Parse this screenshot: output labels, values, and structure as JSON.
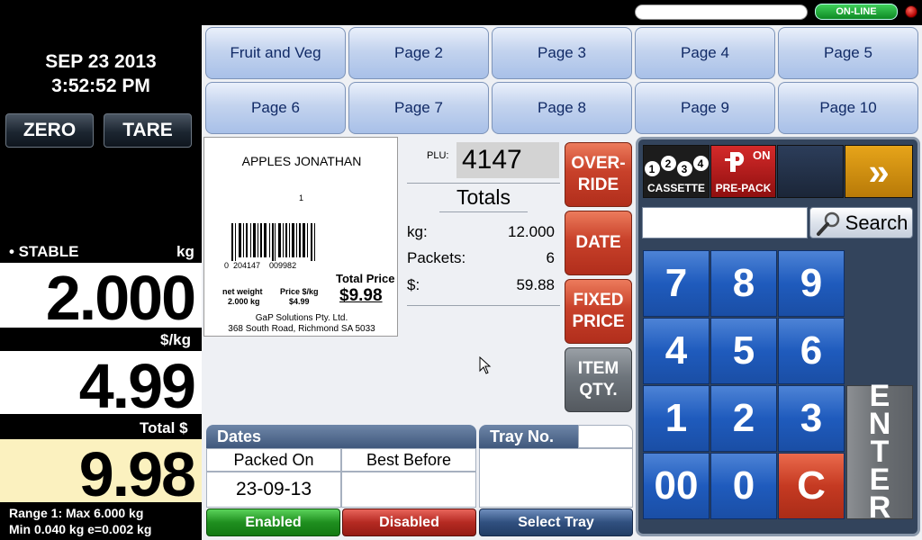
{
  "status": {
    "date": "SEP 23 2013",
    "time": "3:52:52 PM",
    "online_label": "ON-LINE"
  },
  "left_controls": {
    "zero_label": "ZERO",
    "tare_label": "TARE"
  },
  "scale": {
    "stable_label": "• STABLE",
    "weight_unit": "kg",
    "weight": "2.000",
    "price_unit_label": "$/kg",
    "unit_price": "4.99",
    "total_label": "Total $",
    "total": "9.98",
    "range_line1": "Range 1:   Max 6.000 kg",
    "range_line2": "Min 0.040 kg   e=0.002 kg"
  },
  "page_tabs": [
    "Fruit and Veg",
    "Page 2",
    "Page 3",
    "Page 4",
    "Page 5",
    "Page 6",
    "Page 7",
    "Page 8",
    "Page 9",
    "Page 10"
  ],
  "label_preview": {
    "product_name": "APPLES JONATHAN",
    "small_mark": "1",
    "barcode_digits": "0  204147    009982",
    "net_weight_label": "net weight",
    "net_weight_value": "2.000 kg",
    "price_label": "Price $/kg",
    "price_value": "$4.99",
    "total_price_label": "Total Price",
    "total_price_value": "$9.98",
    "company_line1": "GaP Solutions Pty. Ltd.",
    "company_line2": "368 South Road, Richmond SA 5033"
  },
  "plu": {
    "label": "PLU:",
    "value": "4147"
  },
  "totals": {
    "title": "Totals",
    "rows": [
      {
        "label": "kg:",
        "value": "12.000"
      },
      {
        "label": "Packets:",
        "value": "6"
      },
      {
        "label": "$:",
        "value": "59.88"
      }
    ]
  },
  "actions": {
    "override_line1": "OVER-",
    "override_line2": "RIDE",
    "date": "DATE",
    "fixed_line1": "FIXED",
    "fixed_line2": "PRICE",
    "item_line1": "ITEM",
    "item_line2": "QTY."
  },
  "dates_section": {
    "title": "Dates",
    "packed_on_label": "Packed On",
    "packed_on_value": "23-09-13",
    "best_before_label": "Best Before",
    "best_before_value": "",
    "enabled_label": "Enabled",
    "disabled_label": "Disabled"
  },
  "tray": {
    "title": "Tray No.",
    "select_label": "Select Tray"
  },
  "keypad": {
    "cassette_digits": [
      "1",
      "2",
      "3",
      "4"
    ],
    "cassette_label": "CASSETTE",
    "prepack_on": "ON",
    "prepack_label": "PRE-PACK",
    "forward_label": "»",
    "search_label": "Search",
    "search_value": "",
    "keys": [
      "7",
      "8",
      "9",
      "4",
      "5",
      "6",
      "1",
      "2",
      "3",
      "00",
      "0",
      "C"
    ],
    "enter_letters": [
      "E",
      "N",
      "T",
      "E",
      "R"
    ]
  },
  "colors": {
    "online_green": "#1fa637",
    "action_red": "#c8412a",
    "key_blue": "#1f5bbd",
    "readout_yellow": "#fbf1bf"
  }
}
